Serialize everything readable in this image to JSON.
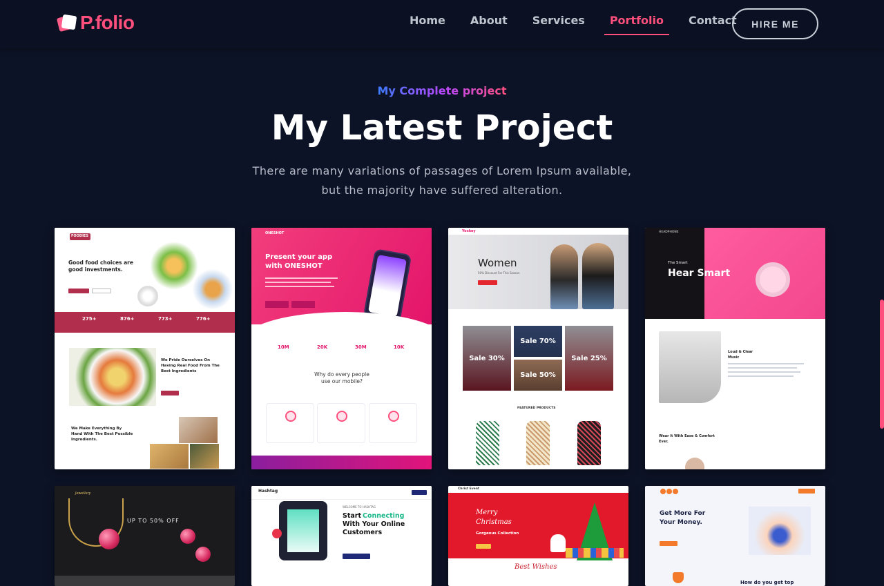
{
  "brand": {
    "name": "P.folio",
    "accent": "#ff4f7d",
    "background": "#0d1326"
  },
  "nav": {
    "items": [
      {
        "label": "Home",
        "active": false
      },
      {
        "label": "About",
        "active": false
      },
      {
        "label": "Services",
        "active": false
      },
      {
        "label": "Portfolio",
        "active": true
      },
      {
        "label": "Contact",
        "active": false
      }
    ],
    "cta_label": "HIRE ME"
  },
  "section": {
    "eyebrow": "My Complete project",
    "title": "My Latest Project",
    "description_line1": "There are many variations of passages of Lorem Ipsum available,",
    "description_line2": "but the majority have suffered alteration."
  },
  "projects": {
    "foodies": {
      "logo": "FOODIES",
      "headline": "Good food choices are good investments.",
      "stats": [
        "275+",
        "876+",
        "773+",
        "776+"
      ],
      "feature": "We Pride Ourselves On Having Real Food From The Best Ingredients",
      "feature2": "We Make Everything By Hand With The Best Possible Ingredients."
    },
    "oneshot": {
      "logo": "ONESHOT",
      "headline": "Present your app with ONESHOT",
      "stats": [
        "10M",
        "20K",
        "30M",
        "10K"
      ],
      "question": "Why do every people use our mobile?"
    },
    "fashion": {
      "logo": "Yoxkey",
      "headline": "Women",
      "subline": "50% Discount For This Season",
      "sale_tiles": [
        "Sale 30%",
        "Sale 70%",
        "Sale 50%",
        "Sale 25%"
      ],
      "products_title": "FEATURED PRODUCTS"
    },
    "music": {
      "logo": "HEADPHONE",
      "kicker": "The Smart",
      "headline": "Hear Smart",
      "feature": "Loud & Clear Music",
      "comfort": "Wear it With Ease & Comfort Ever."
    },
    "jewelry": {
      "logo": "Jewellery",
      "headline": "UP TO 50% OFF"
    },
    "hashtag": {
      "logo": "Hashtag",
      "kicker": "WELCOME TO HASHTAG",
      "headline_1": "Start",
      "headline_accent": "Connecting",
      "headline_2": "With Your Online Customers"
    },
    "christmas": {
      "logo": "Christ Event",
      "headline": "Merry Christmas",
      "subline": "Gorgeous Collection",
      "footer_script": "Best Wishes"
    },
    "finance": {
      "headline": "Get More For Your Money.",
      "bottom": "How do you get top"
    }
  }
}
